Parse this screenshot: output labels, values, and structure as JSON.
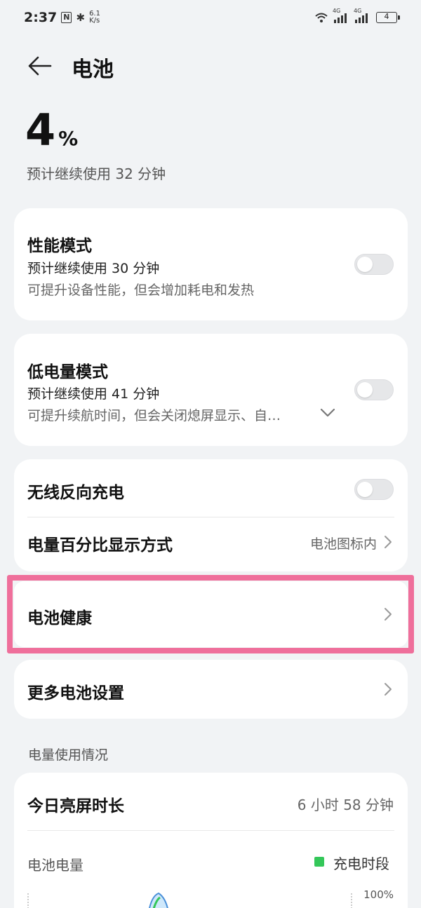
{
  "status_bar": {
    "time": "2:37",
    "nfc_glyph": "N",
    "bluetooth_glyph": "✱",
    "speed_value": "6.1",
    "speed_unit": "K/s",
    "signal1_tag": "4G",
    "signal2_tag": "4G",
    "battery_level": "4"
  },
  "header": {
    "title": "电池"
  },
  "battery": {
    "percent": "4",
    "percent_sign": "%",
    "remaining": "预计继续使用 32 分钟"
  },
  "performance_mode": {
    "title": "性能模式",
    "estimate": "预计继续使用 30 分钟",
    "description": "可提升设备性能，但会增加耗电和发热",
    "enabled": false
  },
  "low_power_mode": {
    "title": "低电量模式",
    "estimate": "预计继续使用 41 分钟",
    "description": "可提升续航时间，但会关闭熄屏显示、自…",
    "enabled": false
  },
  "wireless_reverse": {
    "title": "无线反向充电",
    "enabled": false
  },
  "percent_display": {
    "title": "电量百分比显示方式",
    "value": "电池图标内"
  },
  "battery_health": {
    "title": "电池健康"
  },
  "more_settings": {
    "title": "更多电池设置"
  },
  "usage": {
    "section_label": "电量使用情况",
    "screen_time_label": "今日亮屏时长",
    "screen_time_value": "6 小时 58 分钟",
    "battery_level_label": "电池电量",
    "legend_charging": "充电时段",
    "y_max_label": "100%"
  },
  "colors": {
    "highlight": "#ef6f9b",
    "charging_legend": "#34c759",
    "background": "#f1f3f5"
  }
}
